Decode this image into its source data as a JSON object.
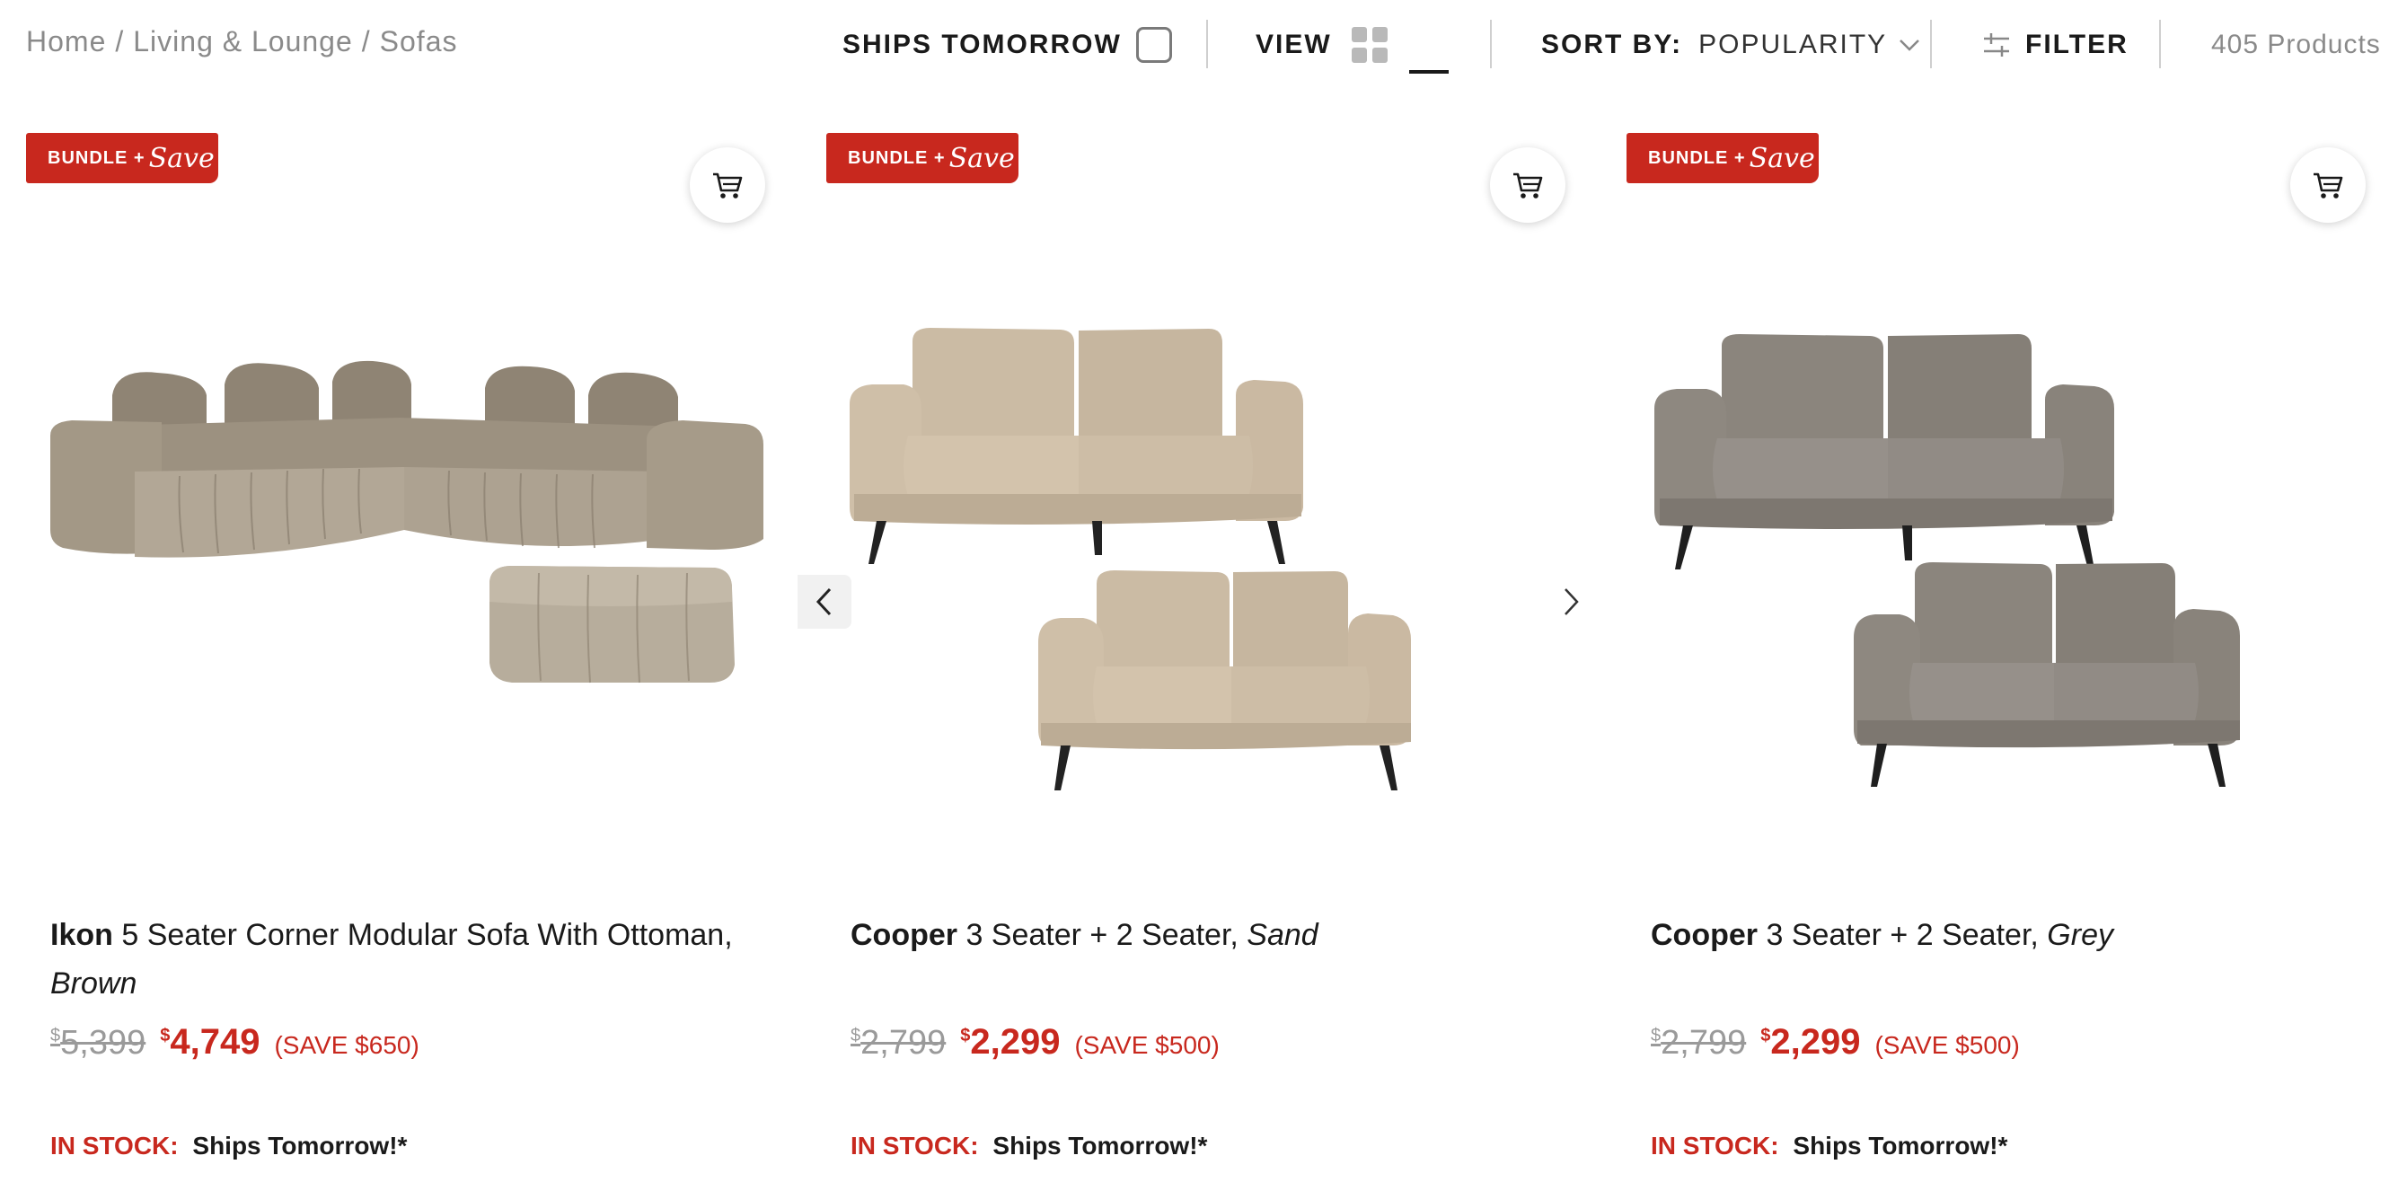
{
  "breadcrumb": [
    "Home",
    "Living & Lounge",
    "Sofas"
  ],
  "breadcrumb_separator": "/",
  "toolbar": {
    "ships_tomorrow_label": "SHIPS TOMORROW",
    "ships_tomorrow_checked": false,
    "view_label": "VIEW",
    "sort_label": "SORT BY:",
    "sort_value": "POPULARITY",
    "filter_label": "FILTER",
    "product_count": "405 Products"
  },
  "colors": {
    "accent_red": "#c8281e",
    "muted_text": "#8a8a8a"
  },
  "products": [
    {
      "badge_main": "BUNDLE +",
      "badge_script": "Save",
      "brand": "Ikon",
      "name": "5 Seater Corner Modular Sofa With Ottoman,",
      "variant": "Brown",
      "price_was_symbol": "$",
      "price_was": "5,399",
      "price_now_symbol": "$",
      "price_now": "4,749",
      "save_text": "(SAVE $650)",
      "stock_label": "IN STOCK:",
      "stock_text": "Ships Tomorrow!*",
      "image_icon": "sofa-corner-modular-with-ottoman"
    },
    {
      "badge_main": "BUNDLE +",
      "badge_script": "Save",
      "brand": "Cooper",
      "name": "3 Seater + 2 Seater,",
      "variant": "Sand",
      "price_was_symbol": "$",
      "price_was": "2,799",
      "price_now_symbol": "$",
      "price_now": "2,299",
      "save_text": "(SAVE $500)",
      "stock_label": "IN STOCK:",
      "stock_text": "Ships Tomorrow!*",
      "image_icon": "sofa-3-plus-2-sand"
    },
    {
      "badge_main": "BUNDLE +",
      "badge_script": "Save",
      "brand": "Cooper",
      "name": "3 Seater + 2 Seater,",
      "variant": "Grey",
      "price_was_symbol": "$",
      "price_was": "2,799",
      "price_now_symbol": "$",
      "price_now": "2,299",
      "save_text": "(SAVE $500)",
      "stock_label": "IN STOCK:",
      "stock_text": "Ships Tomorrow!*",
      "image_icon": "sofa-3-plus-2-grey"
    }
  ]
}
